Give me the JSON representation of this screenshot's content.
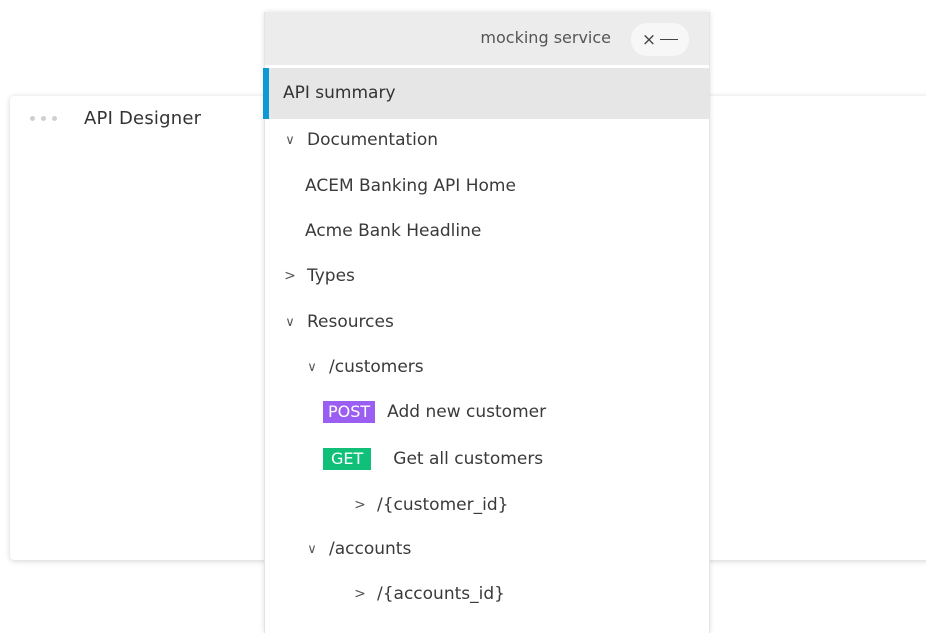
{
  "background_window": {
    "title": "API Designer"
  },
  "panel": {
    "header": {
      "title": "mocking service",
      "close_symbol": "×",
      "accent_color": "#0c99d6"
    },
    "active_item": "API summary",
    "documentation": {
      "label": "Documentation",
      "items": [
        "ACEM Banking API Home",
        "Acme Bank Headline"
      ]
    },
    "types": {
      "label": "Types"
    },
    "resources": {
      "label": "Resources",
      "customers": {
        "label": "/customers",
        "methods": [
          {
            "verb": "POST",
            "label": "Add new customer",
            "color": "#9b5ef2"
          },
          {
            "verb": "GET",
            "label": "Get all customers",
            "color": "#10c079"
          }
        ],
        "child": "/{customer_id}"
      },
      "accounts": {
        "label": "/accounts",
        "child": "/{accounts_id}"
      }
    }
  }
}
